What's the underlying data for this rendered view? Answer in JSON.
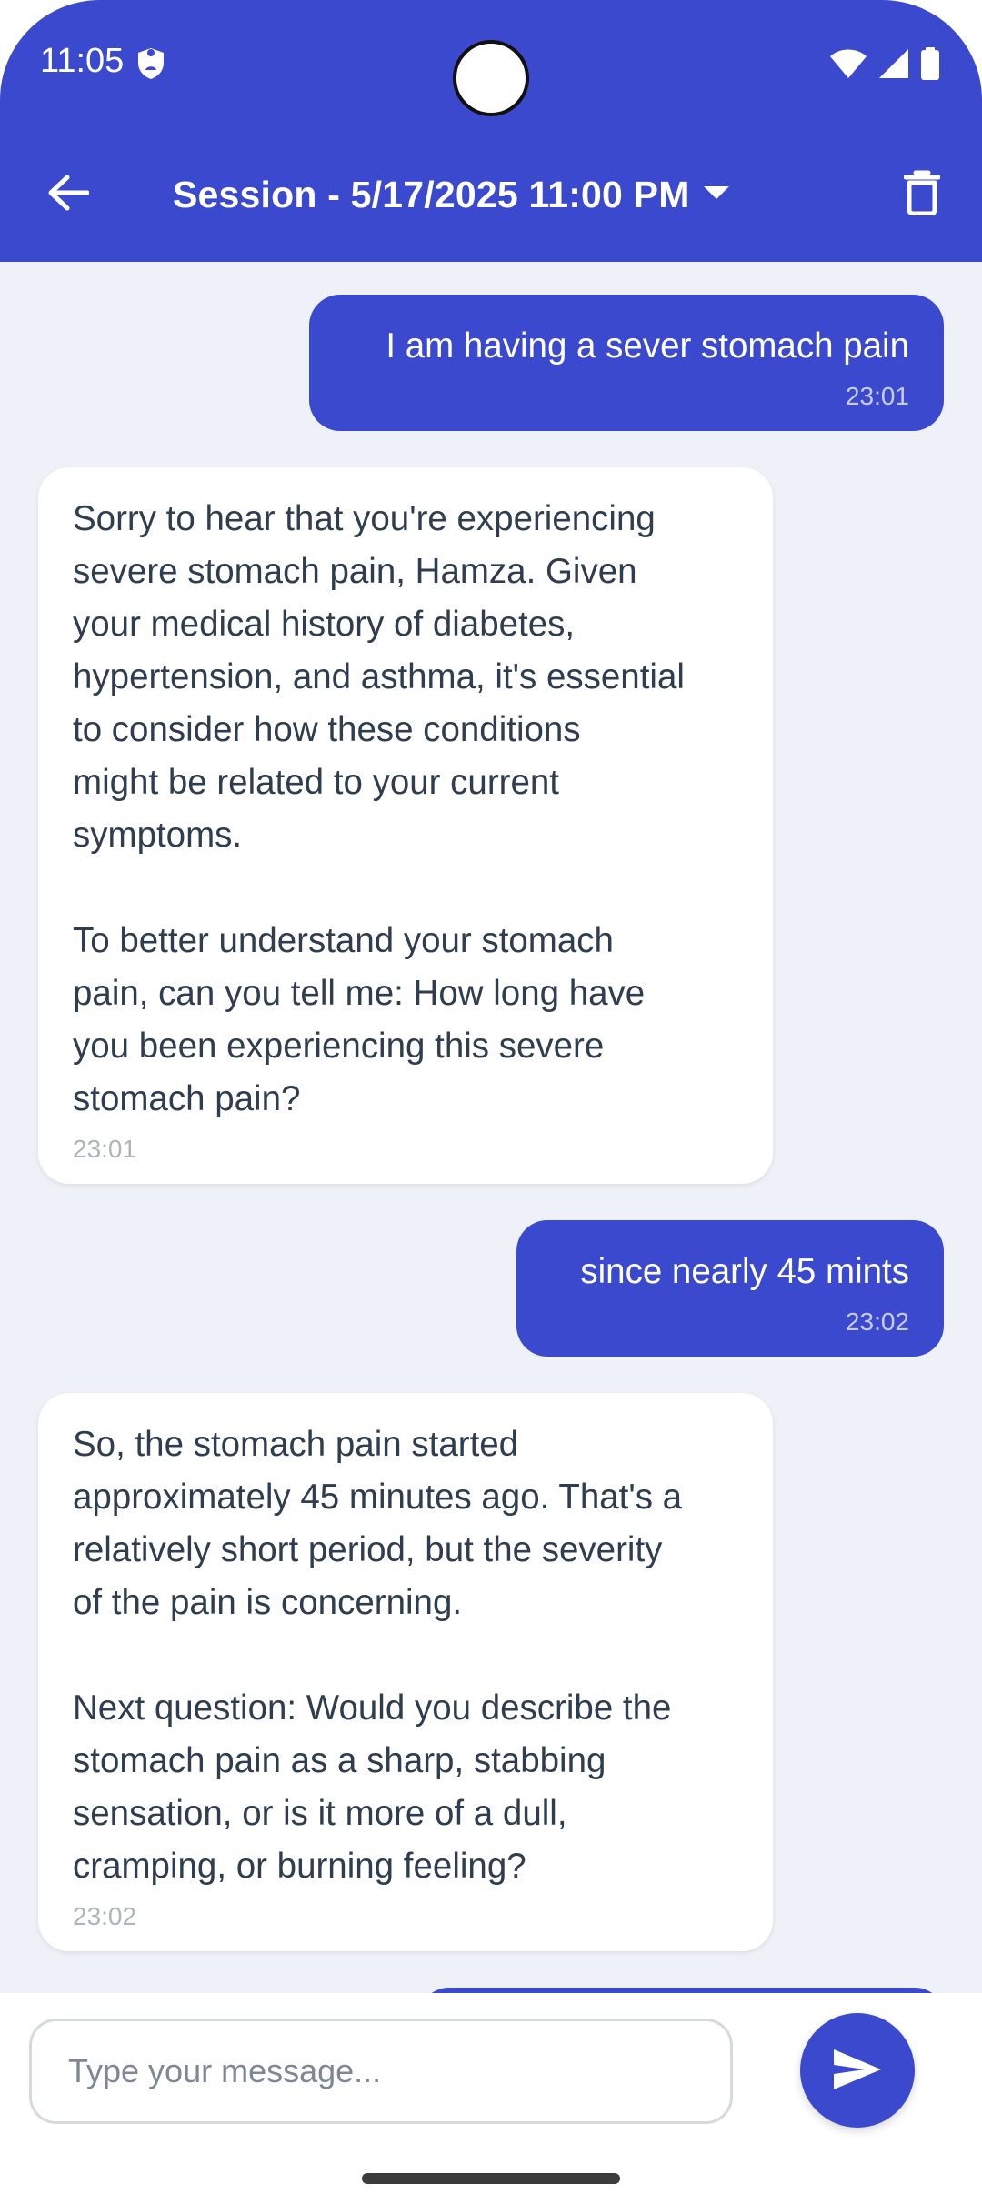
{
  "status_bar": {
    "time": "11:05"
  },
  "app_bar": {
    "title": "Session - 5/17/2025 11:00 PM"
  },
  "messages": [
    {
      "role": "user",
      "text": "I am having a sever stomach pain",
      "time": "23:01"
    },
    {
      "role": "bot",
      "text": "Sorry to hear that you're experiencing\nsevere stomach pain, Hamza. Given\nyour medical history of diabetes,\nhypertension, and asthma, it's essential\nto consider how these conditions\nmight be related to your current\nsymptoms.\n\nTo better understand your stomach\npain, can you tell me: How long have\nyou been experiencing this severe\nstomach pain?",
      "time": "23:01"
    },
    {
      "role": "user",
      "text": "since nearly 45 mints",
      "time": "23:02"
    },
    {
      "role": "bot",
      "text": "So, the stomach pain started\napproximately 45 minutes ago. That's a\nrelatively short period, but the severity\nof the pain is concerning.\n\nNext question: Would you describe the\nstomach pain as a sharp, stabbing\nsensation, or is it more of a dull,\ncramping, or burning feeling?",
      "time": "23:02"
    }
  ],
  "composer": {
    "placeholder": "Type your message..."
  },
  "colors": {
    "primary": "#3b49cf",
    "background": "#eef1f7",
    "bot_bubble": "#ffffff",
    "bot_text": "#2e3d4f"
  },
  "icons": {
    "back": "arrow-left-icon",
    "title_dropdown": "caret-down-icon",
    "delete": "trash-icon",
    "send": "send-icon"
  }
}
